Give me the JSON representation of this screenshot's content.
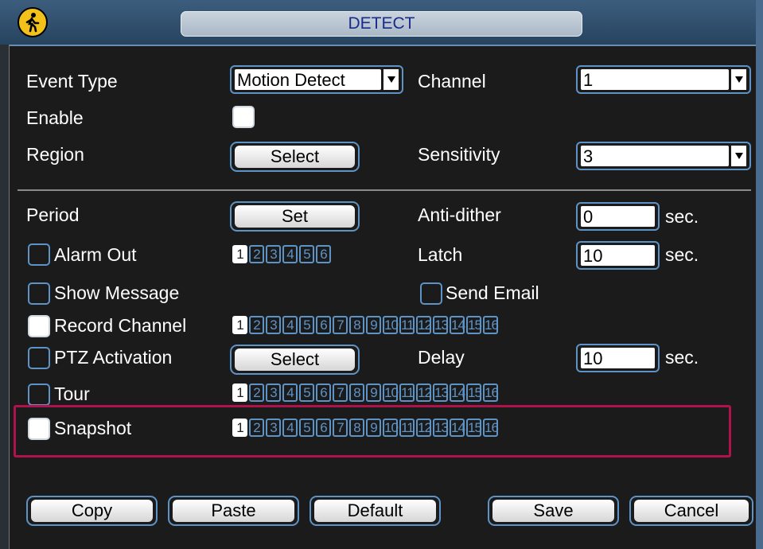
{
  "window": {
    "title": "DETECT",
    "logo_icon": "walking-person-icon"
  },
  "form": {
    "event_type": {
      "label": "Event Type",
      "value": "Motion Detect"
    },
    "channel": {
      "label": "Channel",
      "value": "1"
    },
    "enable": {
      "label": "Enable",
      "checked": true
    },
    "region": {
      "label": "Region",
      "button": "Select"
    },
    "sensitivity": {
      "label": "Sensitivity",
      "value": "3"
    },
    "period": {
      "label": "Period",
      "button": "Set"
    },
    "anti_dither": {
      "label": "Anti-dither",
      "value": "0",
      "unit": "sec."
    },
    "alarm_out": {
      "label": "Alarm Out",
      "checked": false,
      "numbers": [
        "1",
        "2",
        "3",
        "4",
        "5",
        "6"
      ],
      "selected": [
        "1"
      ]
    },
    "latch": {
      "label": "Latch",
      "value": "10",
      "unit": "sec."
    },
    "show_message": {
      "label": "Show Message",
      "checked": false
    },
    "send_email": {
      "label": "Send Email",
      "checked": false
    },
    "record_channel": {
      "label": "Record Channel",
      "checked": true,
      "numbers": [
        "1",
        "2",
        "3",
        "4",
        "5",
        "6",
        "7",
        "8",
        "9",
        "10",
        "11",
        "12",
        "13",
        "14",
        "15",
        "16"
      ],
      "selected": [
        "1"
      ]
    },
    "ptz_activation": {
      "label": "PTZ Activation",
      "checked": false,
      "button": "Select"
    },
    "delay": {
      "label": "Delay",
      "value": "10",
      "unit": "sec."
    },
    "tour": {
      "label": "Tour",
      "checked": false,
      "numbers": [
        "1",
        "2",
        "3",
        "4",
        "5",
        "6",
        "7",
        "8",
        "9",
        "10",
        "11",
        "12",
        "13",
        "14",
        "15",
        "16"
      ],
      "selected": [
        "1"
      ]
    },
    "snapshot": {
      "label": "Snapshot",
      "checked": true,
      "numbers": [
        "1",
        "2",
        "3",
        "4",
        "5",
        "6",
        "7",
        "8",
        "9",
        "10",
        "11",
        "12",
        "13",
        "14",
        "15",
        "16"
      ],
      "selected": [
        "1"
      ]
    }
  },
  "buttons": {
    "copy": "Copy",
    "paste": "Paste",
    "default": "Default",
    "save": "Save",
    "cancel": "Cancel"
  },
  "colors": {
    "accent": "#5e93c6",
    "highlight": "#b0134c",
    "title_text": "#1a2c8a"
  }
}
